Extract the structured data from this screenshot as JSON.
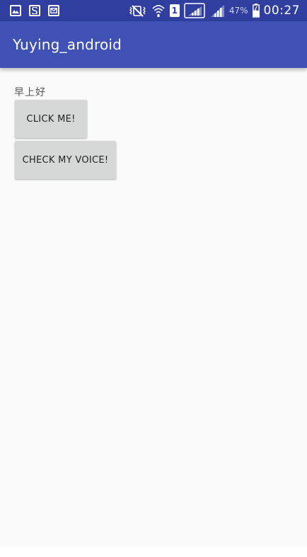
{
  "status_bar": {
    "left_icons": [
      "image-notification-icon",
      "s-notification-icon",
      "message-notification-icon"
    ],
    "right_icons": [
      "vibrate-icon",
      "wifi-icon",
      "sim-1-icon",
      "signal-1-icon",
      "signal-2-icon",
      "battery-icon"
    ],
    "sim_label": "1",
    "battery_percent": "47%",
    "time": "00:27"
  },
  "app_bar": {
    "title": "Yuying_android"
  },
  "main": {
    "greeting": "早上好",
    "click_button_label": "CLICK ME!",
    "voice_button_label": "CHECK MY VOICE!"
  },
  "colors": {
    "status_bar": "#303f9f",
    "app_bar": "#3f51b5",
    "background": "#fafafa",
    "button": "#d6d7d7"
  }
}
